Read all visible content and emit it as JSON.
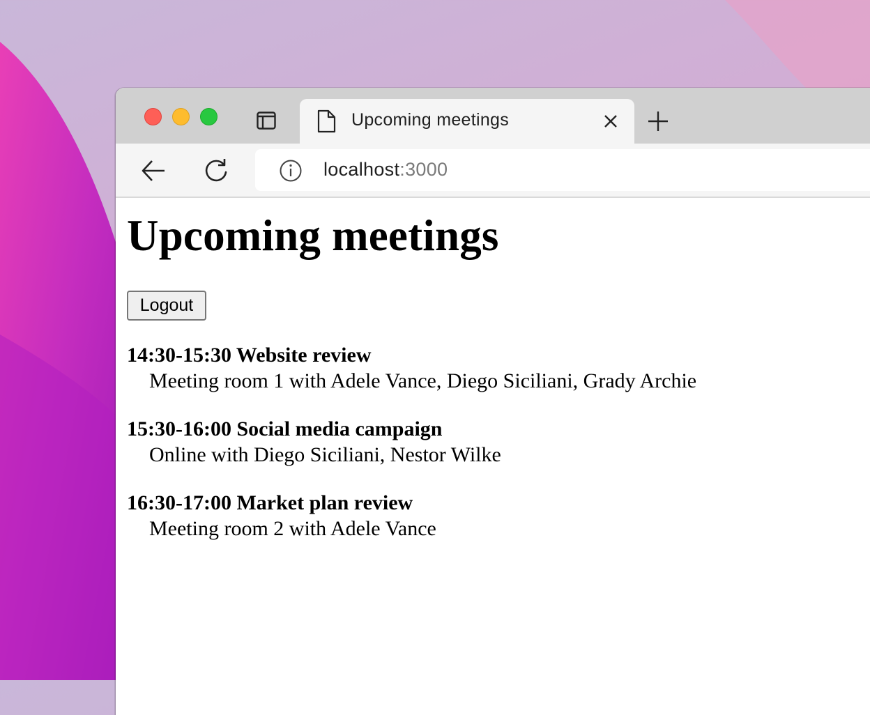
{
  "browser": {
    "tab": {
      "title": "Upcoming meetings",
      "icon": "document-icon"
    },
    "address_bar": {
      "host": "localhost",
      "port": ":3000"
    }
  },
  "page": {
    "heading": "Upcoming meetings",
    "logout_label": "Logout",
    "meetings": [
      {
        "title": "14:30-15:30 Website review",
        "detail": "Meeting room 1 with Adele Vance, Diego Siciliani, Grady Archie"
      },
      {
        "title": "15:30-16:00 Social media campaign",
        "detail": "Online with Diego Siciliani, Nestor Wilke"
      },
      {
        "title": "16:30-17:00 Market plan review",
        "detail": "Meeting room 2 with Adele Vance"
      }
    ]
  },
  "colors": {
    "traffic_close": "#fe5f57",
    "traffic_minimize": "#febc2e",
    "traffic_maximize": "#28c840",
    "desktop_magenta": "#c52dbf"
  }
}
